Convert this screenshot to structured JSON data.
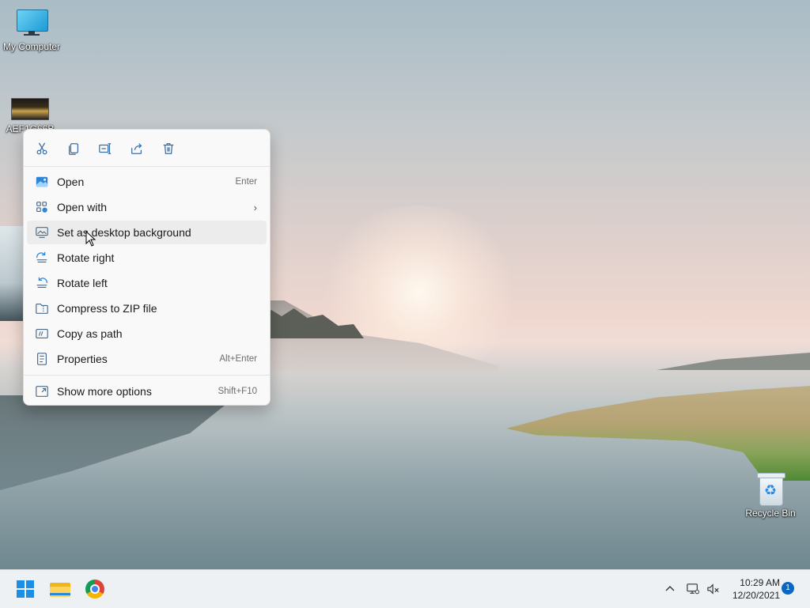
{
  "desktop": {
    "icons": [
      {
        "label": "My Computer"
      },
      {
        "label": "AEF1G66B"
      },
      {
        "label": "Recycle Bin"
      }
    ]
  },
  "context_menu": {
    "toolbar": [
      {
        "icon": "cut-icon"
      },
      {
        "icon": "copy-icon"
      },
      {
        "icon": "rename-icon"
      },
      {
        "icon": "share-icon"
      },
      {
        "icon": "delete-icon"
      }
    ],
    "items": [
      {
        "label": "Open",
        "shortcut": "Enter",
        "icon": "image-icon"
      },
      {
        "label": "Open with",
        "shortcut": "",
        "icon": "open-with-icon",
        "submenu": true
      },
      {
        "label": "Set as desktop background",
        "shortcut": "",
        "icon": "desktop-background-icon",
        "hovered": true
      },
      {
        "label": "Rotate right",
        "shortcut": "",
        "icon": "rotate-right-icon"
      },
      {
        "label": "Rotate left",
        "shortcut": "",
        "icon": "rotate-left-icon"
      },
      {
        "label": "Compress to ZIP file",
        "shortcut": "",
        "icon": "zip-icon"
      },
      {
        "label": "Copy as path",
        "shortcut": "",
        "icon": "copy-path-icon"
      },
      {
        "label": "Properties",
        "shortcut": "Alt+Enter",
        "icon": "properties-icon"
      },
      {
        "label": "Show more options",
        "shortcut": "Shift+F10",
        "icon": "show-more-icon"
      }
    ],
    "submenu_arrow": "›"
  },
  "taskbar": {
    "apps": [
      {
        "icon": "windows-start-icon"
      },
      {
        "icon": "file-explorer-icon"
      },
      {
        "icon": "chrome-icon"
      }
    ],
    "tray": {
      "chevron": "^",
      "time": "10:29 AM",
      "date": "12/20/2021",
      "notification_count": "1"
    }
  },
  "colors": {
    "menu_bg": "#f9f9f9",
    "hover_bg": "#ececec",
    "accent": "#0a67c2"
  }
}
